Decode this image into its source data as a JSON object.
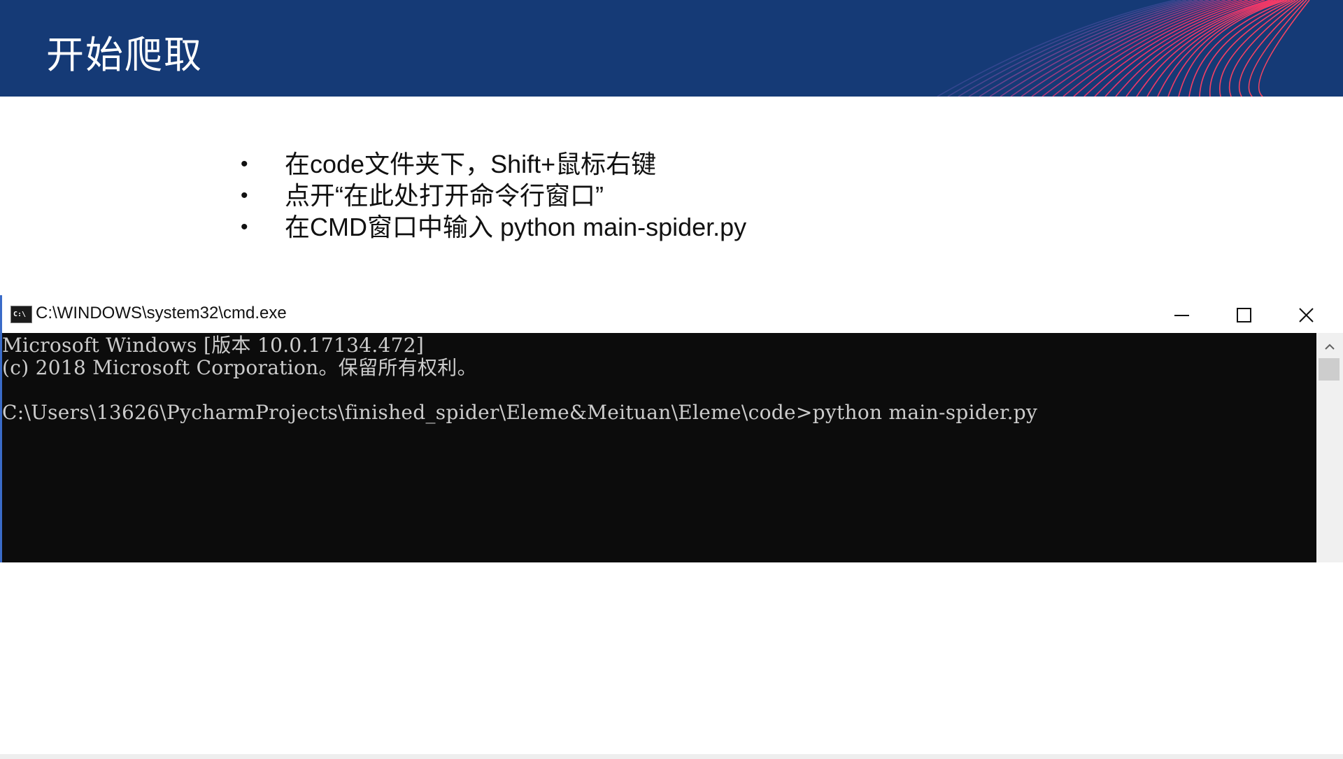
{
  "header": {
    "title": "开始爬取"
  },
  "bullets": [
    "在code文件夹下，Shift+鼠标右键",
    "点开“在此处打开命令行窗口”",
    "在CMD窗口中输入 python main-spider.py"
  ],
  "bullet_symbol": "•",
  "cmd": {
    "title": "C:\\WINDOWS\\system32\\cmd.exe",
    "icon_label": "C:\\",
    "lines": [
      "Microsoft Windows [版本 10.0.17134.472]",
      "(c) 2018 Microsoft Corporation。保留所有权利。",
      "C:\\Users\\13626\\PycharmProjects\\finished_spider\\Eleme&Meituan\\Eleme\\code>python main-spider.py"
    ]
  },
  "colors": {
    "header_bg": "#153a76",
    "cmd_bg": "#0c0c0c",
    "cmd_text": "#cccccc",
    "accent_stripes": "#e0336b"
  },
  "icons": [
    "cmd-app-icon",
    "minimize-icon",
    "maximize-icon",
    "close-icon",
    "scroll-up-icon"
  ]
}
